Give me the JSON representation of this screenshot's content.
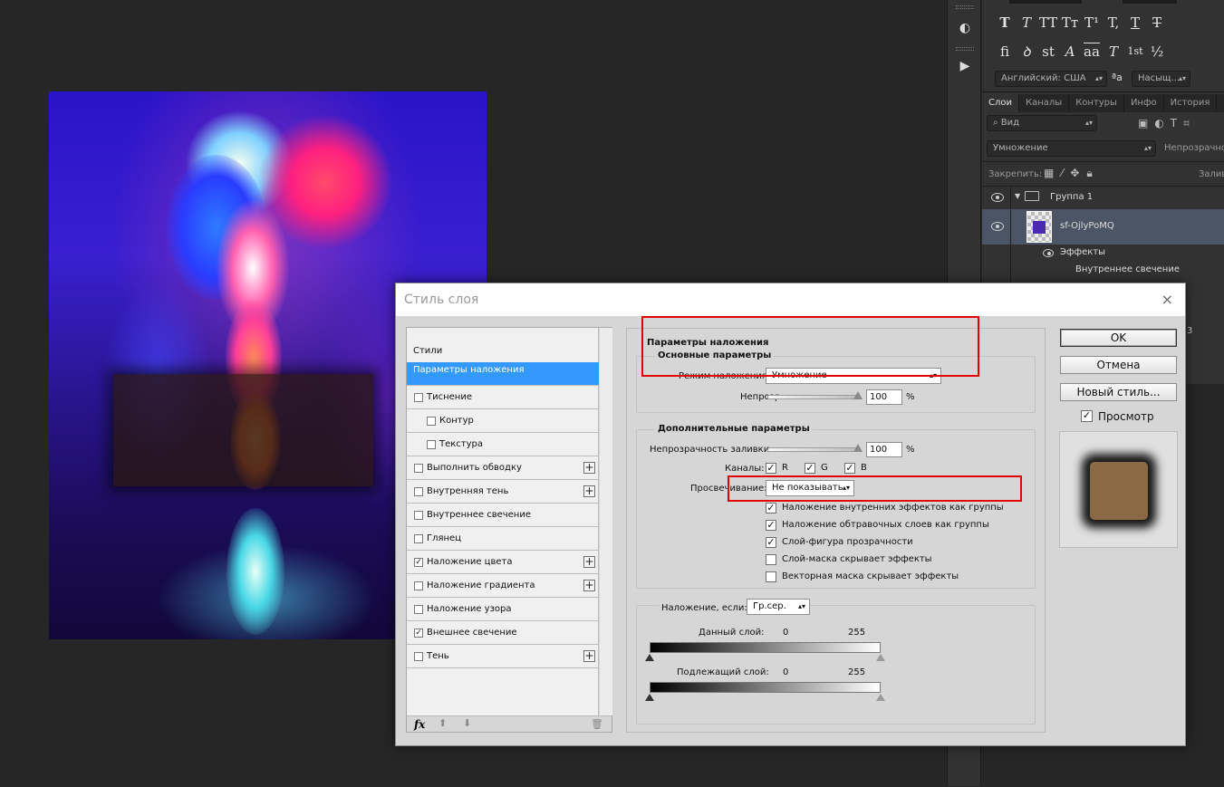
{
  "layers_panel": {
    "tabs": [
      "Слои",
      "Каналы",
      "Контуры",
      "Инфо",
      "История"
    ],
    "filter_placeholder": "Вид",
    "blend_mode": "Умножение",
    "opacity_label": "Непрозрачност",
    "lock_label": "Закрепить:",
    "fill_label": "Залив",
    "group_name": "Группа 1",
    "layer_name": "sf-OjlyPoMQ",
    "effects_label": "Эффекты",
    "effect_item": "Внутреннее свечение",
    "partial_digit": "3"
  },
  "char_panel": {
    "row1": [
      "T",
      "T",
      "TT",
      "Tт",
      "T¹",
      "T,",
      "T",
      "T"
    ],
    "row2": [
      "fi",
      "ꝺ",
      "st",
      "A",
      "aa",
      "T",
      "1st",
      "½"
    ],
    "language": "Английский: США",
    "aa_icon": "ªa",
    "antialias": "Насыщ..."
  },
  "dialog": {
    "title": "Стиль слоя",
    "close": "×",
    "styles_header": "Стили",
    "styles": [
      {
        "label": "Параметры наложения",
        "checked": null,
        "plus": false,
        "selected": true
      },
      {
        "label": "Тиснение",
        "checked": false,
        "plus": false
      },
      {
        "label": "Контур",
        "checked": false,
        "plus": false
      },
      {
        "label": "Текстура",
        "checked": false,
        "plus": false
      },
      {
        "label": "Выполнить обводку",
        "checked": false,
        "plus": true
      },
      {
        "label": "Внутренняя тень",
        "checked": false,
        "plus": true
      },
      {
        "label": "Внутреннее свечение",
        "checked": false,
        "plus": false
      },
      {
        "label": "Глянец",
        "checked": false,
        "plus": false
      },
      {
        "label": "Наложение цвета",
        "checked": true,
        "plus": true
      },
      {
        "label": "Наложение градиента",
        "checked": false,
        "plus": true
      },
      {
        "label": "Наложение узора",
        "checked": false,
        "plus": false
      },
      {
        "label": "Внешнее свечение",
        "checked": true,
        "plus": false
      },
      {
        "label": "Тень",
        "checked": false,
        "plus": true
      }
    ],
    "fx_label": "fx",
    "blend_params_title": "Параметры наложения",
    "basic_title": "Основные параметры",
    "blend_mode_label": "Режим наложения:",
    "blend_mode_value": "Умножение",
    "opacity_label": "Непрозр.:",
    "opacity_value": "100",
    "percent": "%",
    "advanced_title": "Дополнительные параметры",
    "fill_opacity_label": "Непрозрачность заливки:",
    "fill_opacity_value": "100",
    "channels_label": "Каналы:",
    "channel_r": "R",
    "channel_g": "G",
    "channel_b": "B",
    "knockout_label": "Просвечивание:",
    "knockout_value": "Не показывать",
    "options": [
      {
        "label": "Наложение внутренних эффектов как группы",
        "checked": true
      },
      {
        "label": "Наложение обтравочных слоев как группы",
        "checked": true
      },
      {
        "label": "Слой-фигура прозрачности",
        "checked": true
      },
      {
        "label": "Слой-маска скрывает эффекты",
        "checked": false
      },
      {
        "label": "Векторная маска скрывает эффекты",
        "checked": false
      }
    ],
    "blend_if_label": "Наложение, если:",
    "blend_if_value": "Гр.сер.",
    "this_layer_label": "Данный слой:",
    "underlying_label": "Подлежащий слой:",
    "range_min": "0",
    "range_max": "255",
    "ok": "OK",
    "cancel": "Отмена",
    "new_style": "Новый стиль...",
    "preview_label": "Просмотр",
    "preview_checked": true
  },
  "colors": {
    "highlight_red": "#e00000",
    "selection_blue": "#3399ff",
    "swatch": "#8a6a45"
  }
}
